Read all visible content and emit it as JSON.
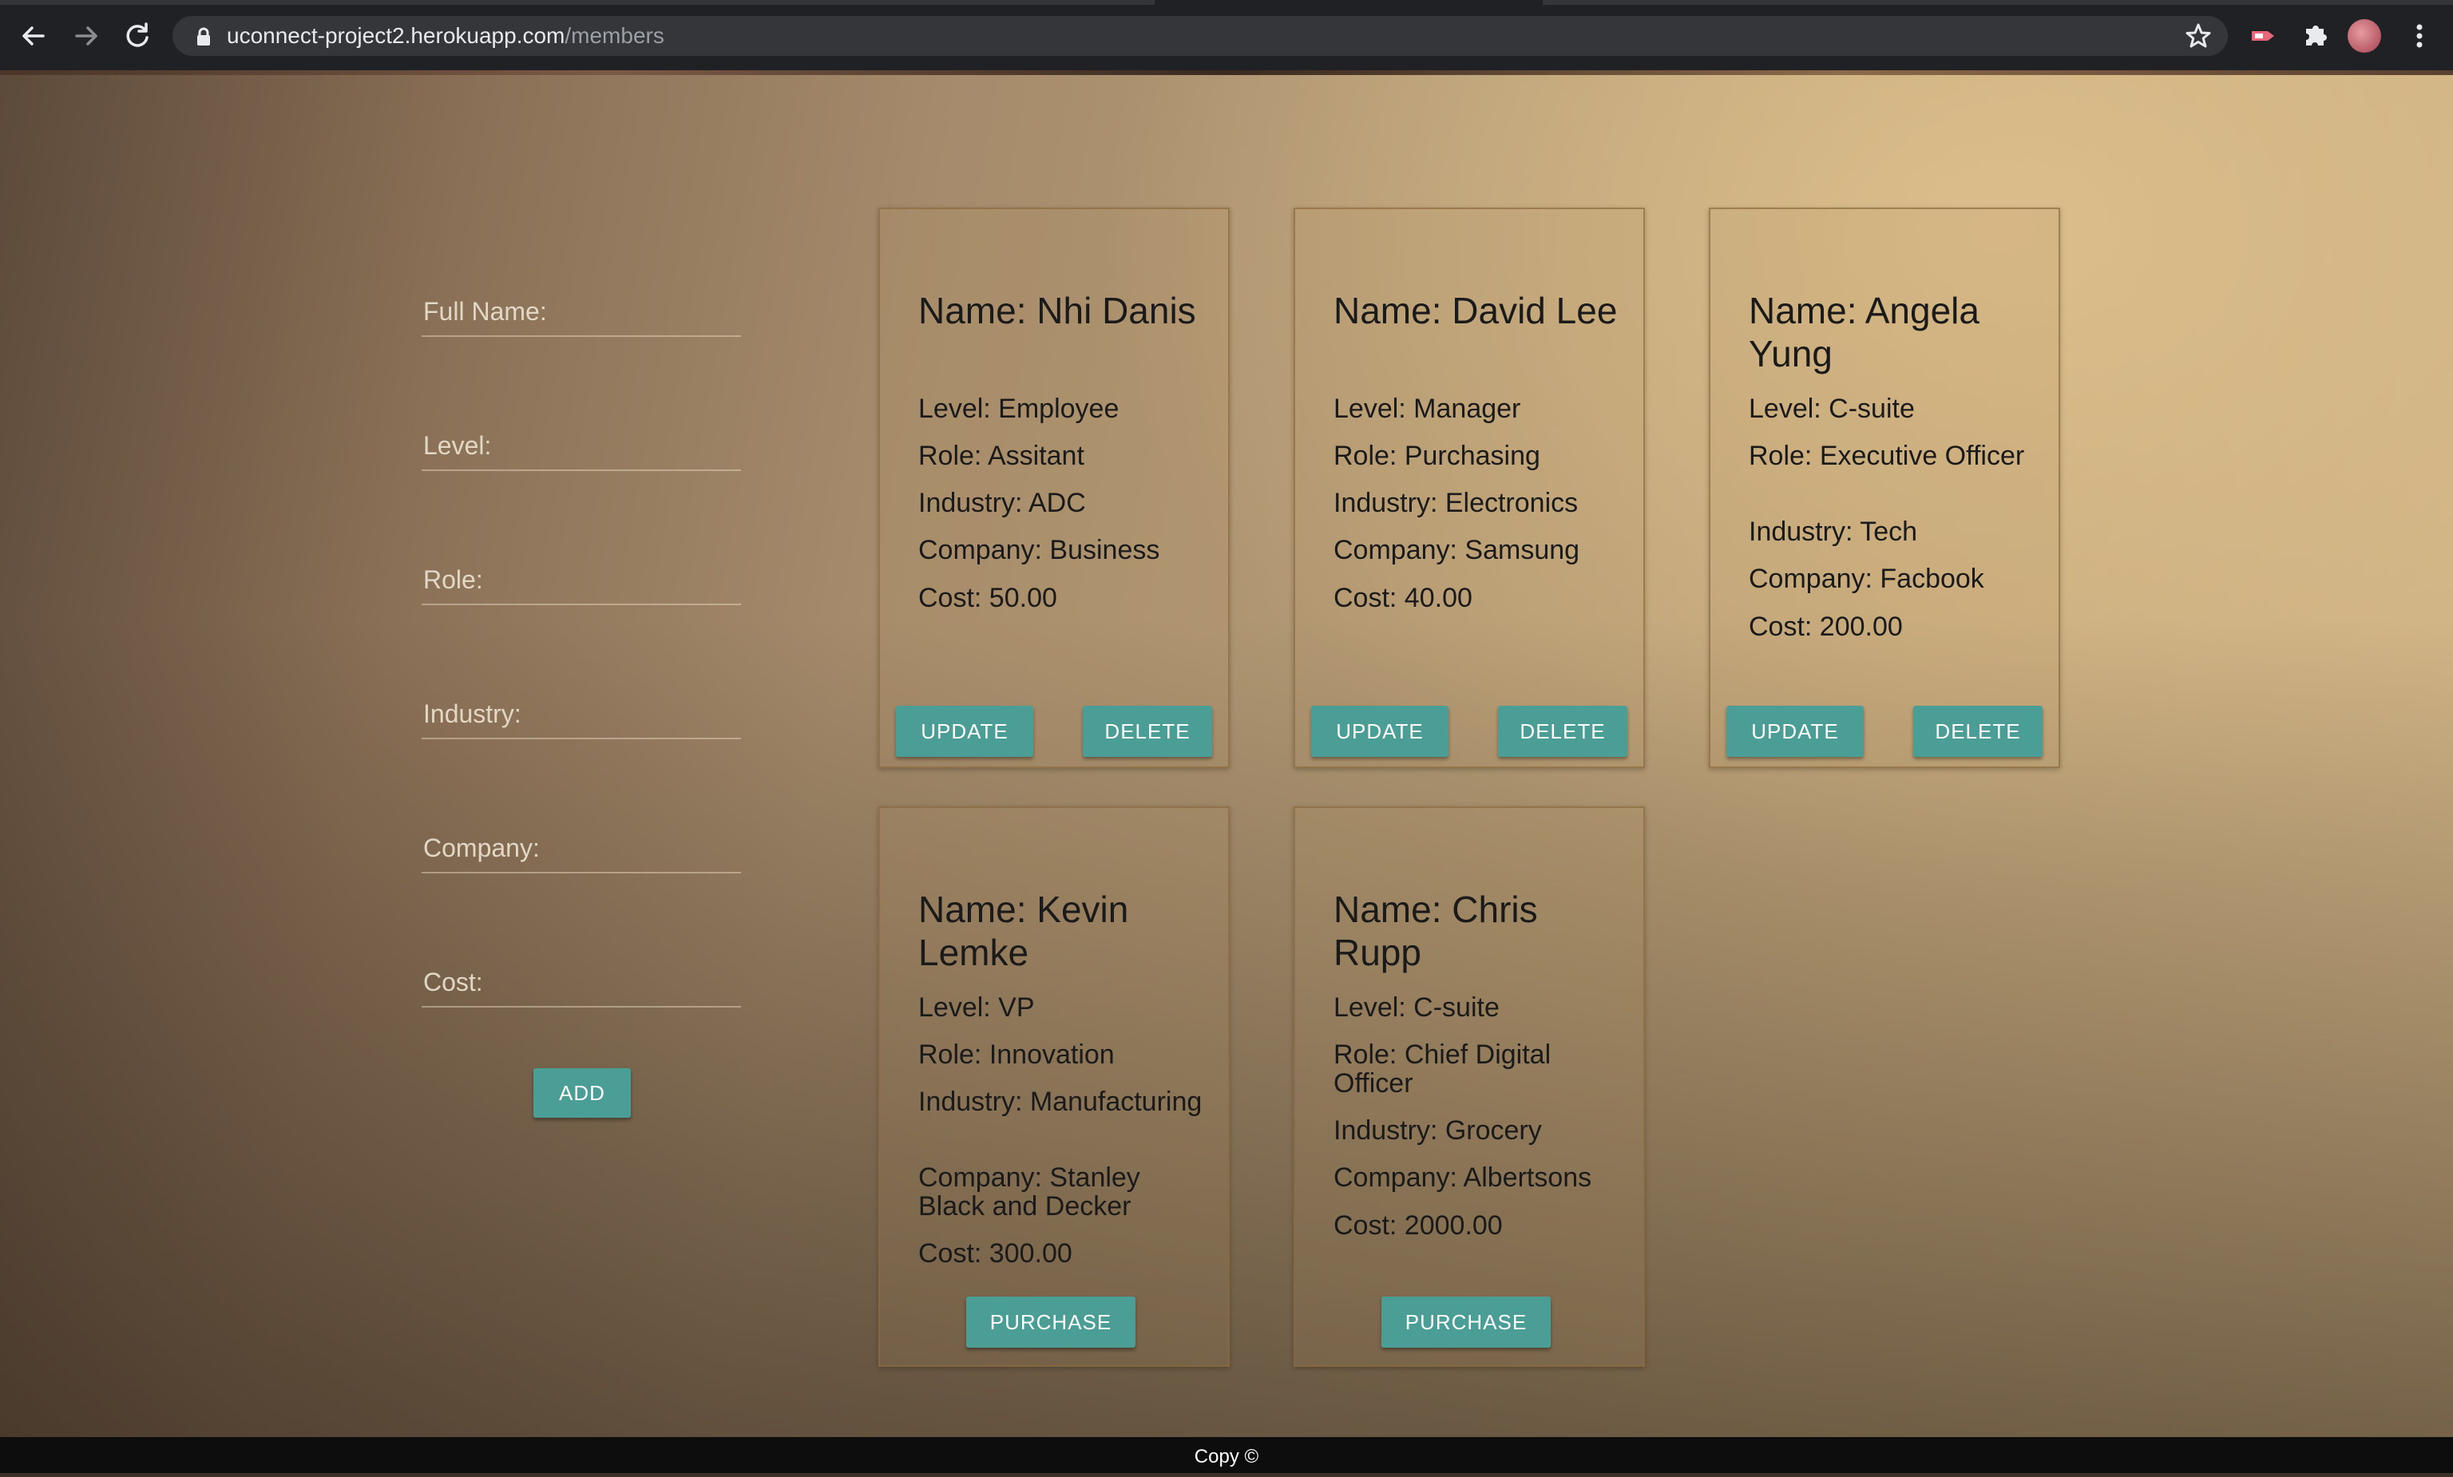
{
  "browser": {
    "url_host": "uconnect-project2.herokuapp.com",
    "url_path": "/members"
  },
  "form": {
    "full_name_placeholder": "Full Name:",
    "level_placeholder": "Level:",
    "role_placeholder": "Role:",
    "industry_placeholder": "Industry:",
    "company_placeholder": "Company:",
    "cost_placeholder": "Cost:",
    "add_label": "ADD"
  },
  "cards": [
    {
      "name": "Name: Nhi Danis",
      "level": "Level: Employee",
      "role": "Role: Assitant",
      "industry": "Industry: ADC",
      "company": "Company: Business",
      "cost": "Cost: 50.00",
      "update_label": "UPDATE",
      "delete_label": "DELETE"
    },
    {
      "name": "Name: David Lee",
      "level": "Level: Manager",
      "role": "Role: Purchasing",
      "industry": "Industry: Electronics",
      "company": "Company: Samsung",
      "cost": "Cost: 40.00",
      "update_label": "UPDATE",
      "delete_label": "DELETE"
    },
    {
      "name": "Name: Angela Yung",
      "level": "Level: C-suite",
      "role": "Role: Executive Officer",
      "industry": "Industry: Tech",
      "company": "Company: Facbook",
      "cost": "Cost: 200.00",
      "update_label": "UPDATE",
      "delete_label": "DELETE"
    },
    {
      "name": "Name: Kevin Lemke",
      "level": "Level: VP",
      "role": "Role: Innovation",
      "industry": "Industry: Manufacturing",
      "company": "Company: Stanley Black and Decker",
      "cost": "Cost: 300.00",
      "purchase_label": "PURCHASE"
    },
    {
      "name": "Name: Chris Rupp",
      "level": "Level: C-suite",
      "role": "Role: Chief Digital Officer",
      "industry": "Industry: Grocery",
      "company": "Company: Albertsons",
      "cost": "Cost: 2000.00",
      "purchase_label": "PURCHASE"
    }
  ],
  "footer": {
    "text": "Copy ©"
  },
  "colors": {
    "button": "#4a9e96",
    "chrome": "#202124",
    "omnibox": "#35363a"
  },
  "icons": [
    "back-arrow-icon",
    "forward-arrow-icon",
    "reload-icon",
    "lock-icon",
    "star-icon",
    "extension-icon",
    "puzzle-icon",
    "avatar",
    "menu-icon"
  ]
}
